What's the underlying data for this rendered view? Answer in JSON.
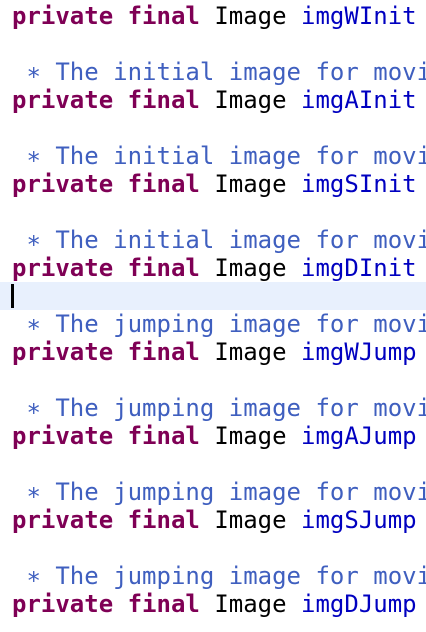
{
  "editor": {
    "keywords": [
      "private",
      "final"
    ],
    "type_name": "Image",
    "comment_prefix": "∗",
    "declarations": [
      {
        "field": "imgWInit",
        "comment": "The initial image for movi"
      },
      {
        "field": "imgAInit",
        "comment": "The initial image for movi"
      },
      {
        "field": "imgSInit",
        "comment": "The initial image for movi"
      },
      {
        "field": "imgDInit",
        "comment": ""
      },
      {
        "field": "imgWJump",
        "comment": "The jumping image for movi"
      },
      {
        "field": "imgAJump",
        "comment": "The jumping image for movi"
      },
      {
        "field": "imgSJump",
        "comment": "The jumping image for movi"
      },
      {
        "field": "imgDJump",
        "comment": "The jumping image for movi"
      }
    ]
  }
}
